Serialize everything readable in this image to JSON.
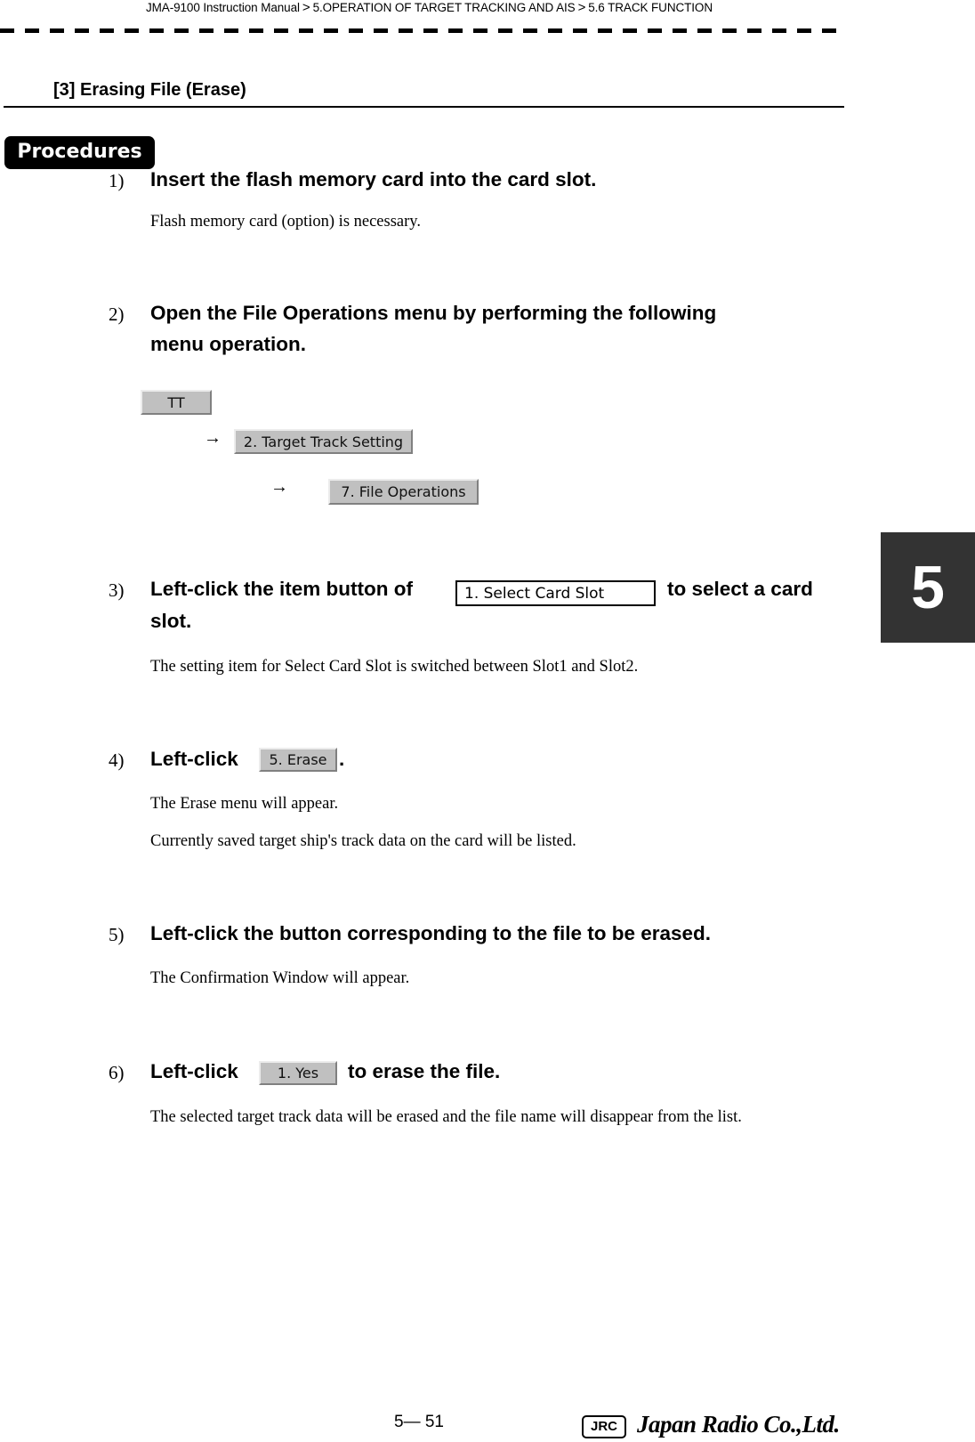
{
  "header": {
    "breadcrumb": [
      "JMA-9100 Instruction Manual",
      "5.OPERATION OF TARGET TRACKING AND AIS",
      "5.6  TRACK FUNCTION"
    ],
    "separator": ">"
  },
  "section": {
    "title": "[3]  Erasing File  (Erase)",
    "badge": "Procedures"
  },
  "steps": [
    {
      "number": "1)",
      "heading": "Insert the flash memory card into the card slot.",
      "descriptions": [
        "Flash memory card (option) is necessary."
      ]
    },
    {
      "number": "2)",
      "heading_line1": "Open the File Operations menu by performing the following",
      "heading_line2": "menu operation.",
      "menu_path": [
        {
          "label": "TT"
        },
        {
          "arrow": "→",
          "label": "2. Target Track Setting"
        },
        {
          "arrow": "→",
          "label": "7. File Operations"
        }
      ]
    },
    {
      "number": "3)",
      "heading_pre": "Left-click the item button of",
      "item_button": "1. Select Card Slot",
      "heading_post": "to select a card",
      "heading_line2": "slot.",
      "descriptions": [
        "The setting item for Select Card Slot is switched between Slot1 and Slot2."
      ]
    },
    {
      "number": "4)",
      "heading_pre": "Left-click",
      "button": "5. Erase",
      "heading_post": ".",
      "descriptions": [
        "The Erase menu will appear.",
        "Currently saved target ship's track data on the card will be listed."
      ]
    },
    {
      "number": "5)",
      "heading": "Left-click the button corresponding to the file to be erased.",
      "descriptions": [
        "The Confirmation Window will appear."
      ]
    },
    {
      "number": "6)",
      "heading_pre": "Left-click",
      "button": "1. Yes",
      "heading_post": "to erase the file.",
      "descriptions": [
        "The selected target track data will be erased and the file name will disappear from the list."
      ]
    }
  ],
  "chapter_tab": "5",
  "footer": {
    "page_number": "5— 51",
    "logo_mark": "JRC",
    "company": "Japan Radio Co.,Ltd."
  },
  "colors": {
    "button_face": "#c0c0c0",
    "chapter_tab": "#333333",
    "badge": "#000000"
  }
}
